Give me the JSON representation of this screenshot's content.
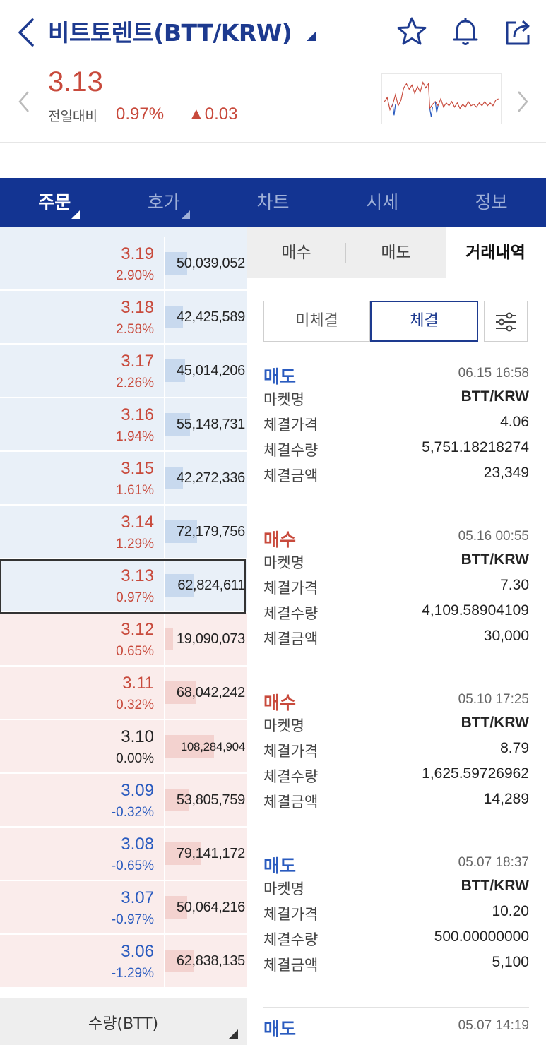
{
  "header": {
    "title": "비트토렌트(BTT/KRW)"
  },
  "summary": {
    "price": "3.13",
    "compare_label": "전일대비",
    "change_pct": "0.97%",
    "change_amt": "▲0.03"
  },
  "tabs": [
    {
      "label": "주문",
      "active": true,
      "caret": true
    },
    {
      "label": "호가",
      "active": false,
      "caret": true
    },
    {
      "label": "차트",
      "active": false,
      "caret": false
    },
    {
      "label": "시세",
      "active": false,
      "caret": false
    },
    {
      "label": "정보",
      "active": false,
      "caret": false
    }
  ],
  "orderbook": {
    "rows": [
      {
        "side": "ask",
        "price": "3.19",
        "pct": "2.90%",
        "dir": "up",
        "qty": "50,039,052",
        "qty_fraction": 0.28
      },
      {
        "side": "ask",
        "price": "3.18",
        "pct": "2.58%",
        "dir": "up",
        "qty": "42,425,589",
        "qty_fraction": 0.22
      },
      {
        "side": "ask",
        "price": "3.17",
        "pct": "2.26%",
        "dir": "up",
        "qty": "45,014,206",
        "qty_fraction": 0.25
      },
      {
        "side": "ask",
        "price": "3.16",
        "pct": "1.94%",
        "dir": "up",
        "qty": "55,148,731",
        "qty_fraction": 0.31
      },
      {
        "side": "ask",
        "price": "3.15",
        "pct": "1.61%",
        "dir": "up",
        "qty": "42,272,336",
        "qty_fraction": 0.22
      },
      {
        "side": "ask",
        "price": "3.14",
        "pct": "1.29%",
        "dir": "up",
        "qty": "72,179,756",
        "qty_fraction": 0.4
      },
      {
        "side": "ask",
        "price": "3.13",
        "pct": "0.97%",
        "dir": "up",
        "qty": "62,824,611",
        "qty_fraction": 0.35
      },
      {
        "side": "bid",
        "price": "3.12",
        "pct": "0.65%",
        "dir": "up",
        "qty": "19,090,073",
        "qty_fraction": 0.1
      },
      {
        "side": "bid",
        "price": "3.11",
        "pct": "0.32%",
        "dir": "up",
        "qty": "68,042,242",
        "qty_fraction": 0.38
      },
      {
        "side": "bid",
        "price": "3.10",
        "pct": "0.00%",
        "dir": "flat",
        "qty": "108,284,904",
        "qty_fraction": 0.6
      },
      {
        "side": "bid",
        "price": "3.09",
        "pct": "-0.32%",
        "dir": "down",
        "qty": "53,805,759",
        "qty_fraction": 0.3
      },
      {
        "side": "bid",
        "price": "3.08",
        "pct": "-0.65%",
        "dir": "down",
        "qty": "79,141,172",
        "qty_fraction": 0.44
      },
      {
        "side": "bid",
        "price": "3.07",
        "pct": "-0.97%",
        "dir": "down",
        "qty": "50,064,216",
        "qty_fraction": 0.28
      },
      {
        "side": "bid",
        "price": "3.06",
        "pct": "-1.29%",
        "dir": "down",
        "qty": "62,838,135",
        "qty_fraction": 0.35
      }
    ],
    "footer_label": "수량(BTT)"
  },
  "right_panel": {
    "tabs": [
      "매수",
      "매도",
      "거래내역"
    ],
    "segments": [
      "미체결",
      "체결"
    ],
    "field_labels": [
      "마켓명",
      "체결가격",
      "체결수량",
      "체결금액"
    ],
    "trades": [
      {
        "type": "매도",
        "kind": "sell",
        "time": "06.15 16:58",
        "market": "BTT/KRW",
        "price": "4.06",
        "volume": "5,751.18218274",
        "amount": "23,349"
      },
      {
        "type": "매수",
        "kind": "buy",
        "time": "05.16 00:55",
        "market": "BTT/KRW",
        "price": "7.30",
        "volume": "4,109.58904109",
        "amount": "30,000"
      },
      {
        "type": "매수",
        "kind": "buy",
        "time": "05.10 17:25",
        "market": "BTT/KRW",
        "price": "8.79",
        "volume": "1,625.59726962",
        "amount": "14,289"
      },
      {
        "type": "매도",
        "kind": "sell",
        "time": "05.07 18:37",
        "market": "BTT/KRW",
        "price": "10.20",
        "volume": "500.00000000",
        "amount": "5,100"
      },
      {
        "type": "매도",
        "kind": "sell",
        "time": "05.07 14:19",
        "market": "",
        "price": "",
        "volume": "",
        "amount": ""
      }
    ]
  },
  "colors": {
    "brand_navy": "#133492",
    "up_red": "#c84a3c",
    "down_blue": "#2a5bbf"
  }
}
